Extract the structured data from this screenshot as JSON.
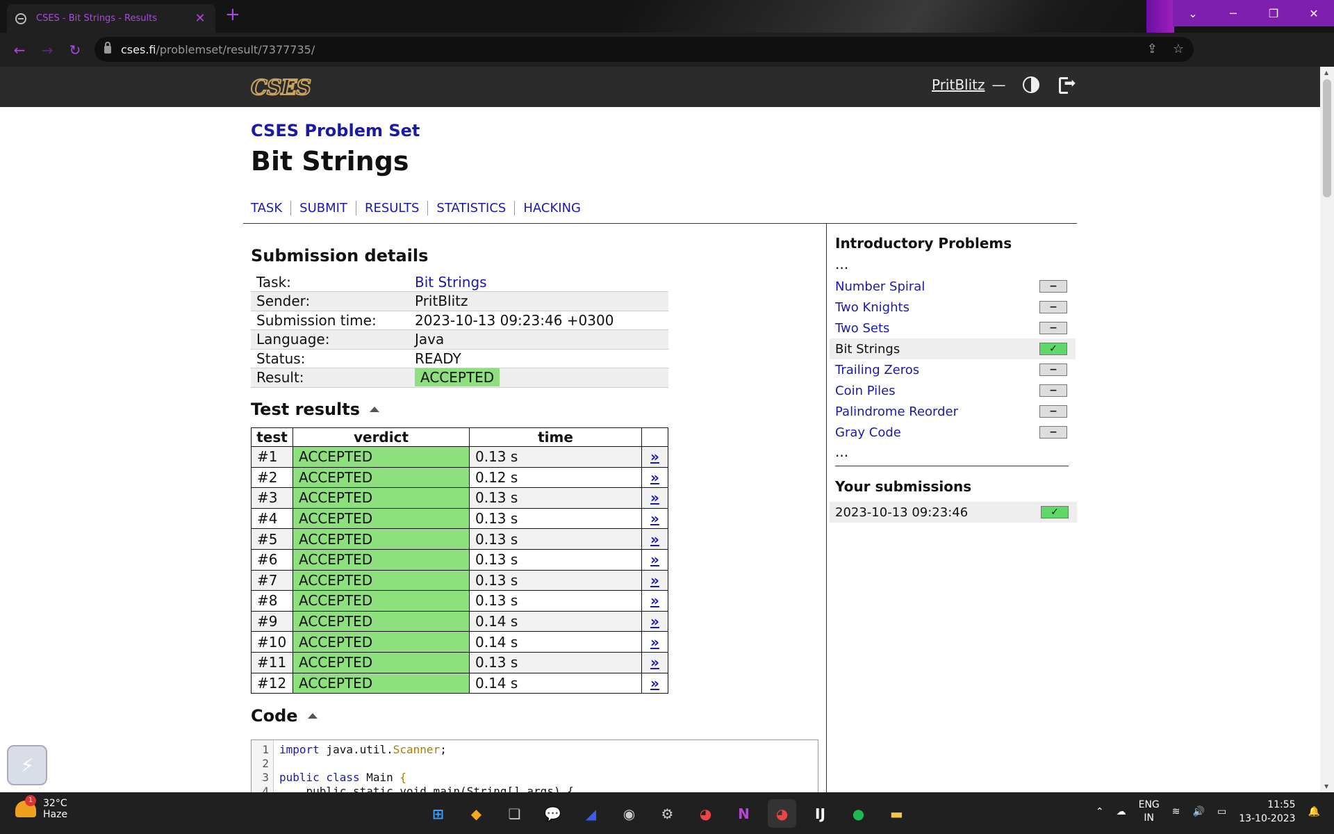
{
  "browser": {
    "tab_title": "CSES - Bit Strings - Results",
    "url_host": "cses.fi",
    "url_path": "/problemset/result/7377735/"
  },
  "site": {
    "logo": "CSES",
    "user": "PritBlitz",
    "separator": "—"
  },
  "header": {
    "problemset": "CSES Problem Set",
    "title": "Bit Strings"
  },
  "nav": [
    "TASK",
    "SUBMIT",
    "RESULTS",
    "STATISTICS",
    "HACKING"
  ],
  "submission": {
    "heading": "Submission details",
    "rows": [
      {
        "k": "Task:",
        "v": "Bit Strings"
      },
      {
        "k": "Sender:",
        "v": "PritBlitz"
      },
      {
        "k": "Submission time:",
        "v": "2023-10-13 09:23:46 +0300"
      },
      {
        "k": "Language:",
        "v": "Java"
      },
      {
        "k": "Status:",
        "v": "READY"
      },
      {
        "k": "Result:",
        "v": "ACCEPTED"
      }
    ]
  },
  "tests": {
    "heading": "Test results",
    "headers": [
      "test",
      "verdict",
      "time"
    ],
    "link": "»",
    "rows": [
      {
        "n": "#1",
        "v": "ACCEPTED",
        "t": "0.13 s"
      },
      {
        "n": "#2",
        "v": "ACCEPTED",
        "t": "0.12 s"
      },
      {
        "n": "#3",
        "v": "ACCEPTED",
        "t": "0.13 s"
      },
      {
        "n": "#4",
        "v": "ACCEPTED",
        "t": "0.13 s"
      },
      {
        "n": "#5",
        "v": "ACCEPTED",
        "t": "0.13 s"
      },
      {
        "n": "#6",
        "v": "ACCEPTED",
        "t": "0.13 s"
      },
      {
        "n": "#7",
        "v": "ACCEPTED",
        "t": "0.13 s"
      },
      {
        "n": "#8",
        "v": "ACCEPTED",
        "t": "0.13 s"
      },
      {
        "n": "#9",
        "v": "ACCEPTED",
        "t": "0.14 s"
      },
      {
        "n": "#10",
        "v": "ACCEPTED",
        "t": "0.14 s"
      },
      {
        "n": "#11",
        "v": "ACCEPTED",
        "t": "0.13 s"
      },
      {
        "n": "#12",
        "v": "ACCEPTED",
        "t": "0.14 s"
      }
    ]
  },
  "code": {
    "heading": "Code",
    "line_numbers": [
      "1",
      "2",
      "3",
      "4"
    ],
    "line1_kw": "import",
    "line1_pkg": " java.util.",
    "line1_cls": "Scanner",
    "line1_end": ";",
    "line3_kw": "public class",
    "line3_name": " Main ",
    "line3_brace": "{",
    "line4": "    public static void main(String[] args) {"
  },
  "sidebar": {
    "title": "Introductory Problems",
    "ellipsis": "...",
    "items": [
      {
        "label": "Number Spiral",
        "mark": "−"
      },
      {
        "label": "Two Knights",
        "mark": "−"
      },
      {
        "label": "Two Sets",
        "mark": "−"
      },
      {
        "label": "Bit Strings",
        "mark": "✓"
      },
      {
        "label": "Trailing Zeros",
        "mark": "−"
      },
      {
        "label": "Coin Piles",
        "mark": "−"
      },
      {
        "label": "Palindrome Reorder",
        "mark": "−"
      },
      {
        "label": "Gray Code",
        "mark": "−"
      }
    ],
    "your_submissions": "Your submissions",
    "submission_time": "2023-10-13 09:23:46",
    "submission_mark": "✓"
  },
  "taskbar": {
    "temp": "32°C",
    "weather": "Haze",
    "weather_badge": "1",
    "lang1": "ENG",
    "lang2": "IN",
    "time": "11:55",
    "date": "13-10-2023"
  },
  "colors": {
    "accent": "#a84be0",
    "accepted": "#8ee07e",
    "link": "#1a1aaa"
  }
}
